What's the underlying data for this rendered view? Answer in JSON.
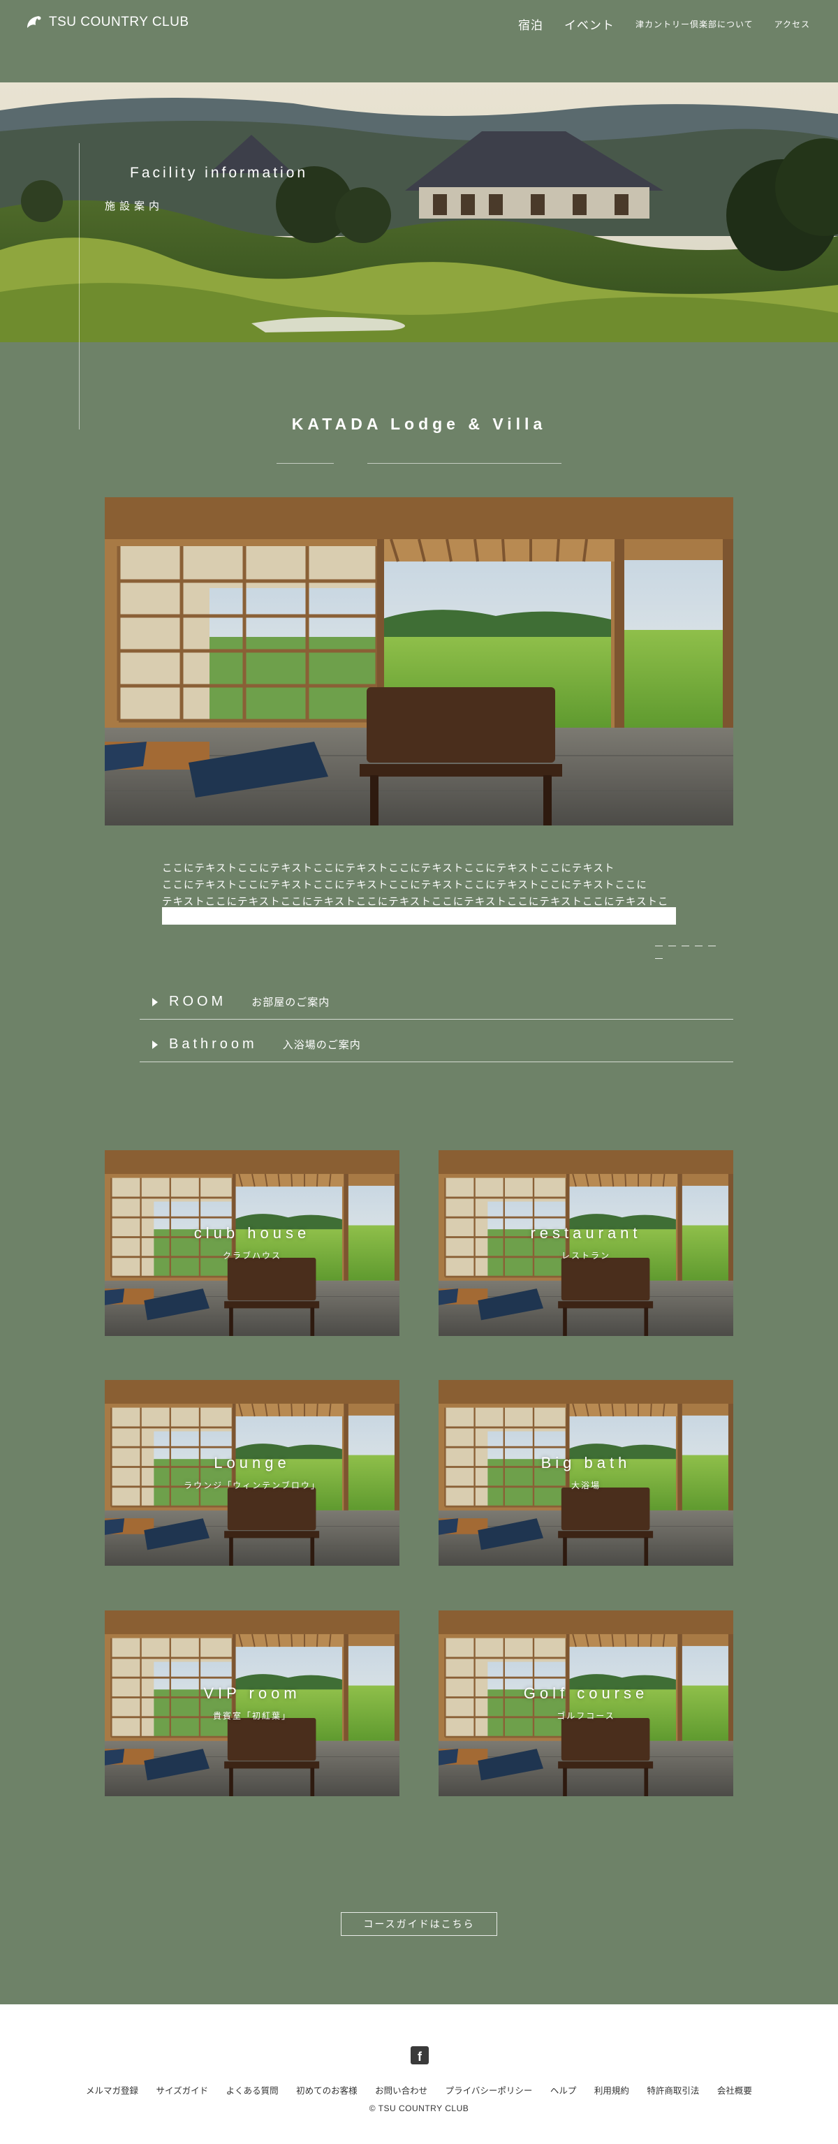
{
  "header": {
    "logo_text": "TSU COUNTRY CLUB",
    "nav": [
      "宿泊",
      "イベント",
      "津カントリー倶楽部について",
      "アクセス"
    ]
  },
  "hero": {
    "title": "Facility information",
    "subtitle": "施設案内"
  },
  "lodge": {
    "title": "KATADA Lodge & Villa",
    "body_lines": [
      "ここにテキストここにテキストここにテキストここにテキストここにテキストここにテキスト",
      "ここにテキストここにテキストここにテキストここにテキストここにテキストここにテキストここに",
      "テキストここにテキストここにテキストここにテキストここにテキストここにテキストここにテキストここに"
    ]
  },
  "accordion": [
    {
      "en": "ROOM",
      "jp": "お部屋のご案内"
    },
    {
      "en": "Bathroom",
      "jp": "入浴場のご案内"
    }
  ],
  "cards": [
    {
      "title": "club house",
      "sub": "クラブハウス"
    },
    {
      "title": "restaurant",
      "sub": "レストラン"
    },
    {
      "title": "Lounge",
      "sub": "ラウンジ「ウィンテンブロウ」"
    },
    {
      "title": "Big bath",
      "sub": "大浴場"
    },
    {
      "title": "VIP room",
      "sub": "貴賓室「初紅葉」"
    },
    {
      "title": "Golf course",
      "sub": "ゴルフコース"
    }
  ],
  "course_button": "コースガイドはこちら",
  "footer": {
    "social_icon": "facebook-icon",
    "links": [
      "メルマガ登録",
      "サイズガイド",
      "よくある質問",
      "初めてのお客様",
      "お問い合わせ",
      "プライバシーポリシー",
      "ヘルプ",
      "利用規約",
      "特許商取引法",
      "会社概要"
    ],
    "copyright": "© TSU COUNTRY CLUB"
  },
  "colors": {
    "page_background": "#6e8268",
    "footer_background": "#ffffff"
  }
}
